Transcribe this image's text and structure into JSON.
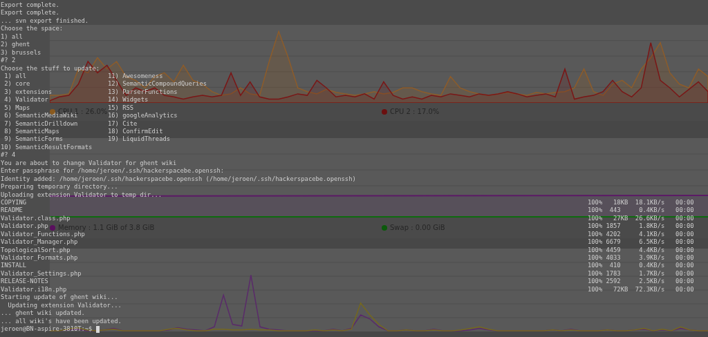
{
  "monitor": {
    "cpu_legend": [
      {
        "label": "CPU 1 : 26.0%",
        "color": "#8a5a1e"
      },
      {
        "label": "CPU 2 : 17.0%",
        "color": "#6b0f0f"
      }
    ],
    "memory_legend": [
      {
        "label": "Memory : 1.1 GiB of 3.8 GiB",
        "color": "#5a0f5e"
      },
      {
        "label": "Swap : 0.00 GiB",
        "color": "#0b5a0b"
      }
    ]
  },
  "terminal": {
    "lines": [
      {
        "kind": "text",
        "text": "Export complete."
      },
      {
        "kind": "text",
        "text": "Export complete."
      },
      {
        "kind": "text",
        "text": "... svn export finished."
      },
      {
        "kind": "text",
        "text": "Choose the space:"
      },
      {
        "kind": "text",
        "text": "1) all"
      },
      {
        "kind": "text",
        "text": "2) ghent"
      },
      {
        "kind": "text",
        "text": "3) brussels"
      },
      {
        "kind": "text",
        "text": "#? 2"
      },
      {
        "kind": "text",
        "text": "Choose the stuff to update:"
      },
      {
        "kind": "menu",
        "left": " 1) all",
        "right": "11) Awesomeness"
      },
      {
        "kind": "menu",
        "left": " 2) core",
        "right": "12) SemanticCompoundQueries"
      },
      {
        "kind": "menu",
        "left": " 3) extensions",
        "right": "13) ParserFunctions"
      },
      {
        "kind": "menu",
        "left": " 4) Validator",
        "right": "14) Widgets"
      },
      {
        "kind": "menu",
        "left": " 5) Maps",
        "right": "15) RSS"
      },
      {
        "kind": "menu",
        "left": " 6) SemanticMediaWiki",
        "right": "16) googleAnalytics"
      },
      {
        "kind": "menu",
        "left": " 7) SemanticDrilldown",
        "right": "17) Cite"
      },
      {
        "kind": "menu",
        "left": " 8) SemanticMaps",
        "right": "18) ConfirmEdit"
      },
      {
        "kind": "menu",
        "left": " 9) SemanticForms",
        "right": "19) LiquidThreads"
      },
      {
        "kind": "menu",
        "left": "10) SemanticResultFormats"
      },
      {
        "kind": "text",
        "text": "#? 4"
      },
      {
        "kind": "text",
        "text": "You are about to change Validator for ghent wiki"
      },
      {
        "kind": "text",
        "text": "Enter passphrase for /home/jeroen/.ssh/hackerspacebe.openssh:"
      },
      {
        "kind": "text",
        "text": "Identity added: /home/jeroen/.ssh/hackerspacebe.openssh (/home/jeroen/.ssh/hackerspacebe.openssh)"
      },
      {
        "kind": "text",
        "text": "Preparing temporary directory..."
      },
      {
        "kind": "text",
        "text": "Uploading extension Validator to temp dir..."
      },
      {
        "kind": "transfer",
        "name": "COPYING",
        "stats": "100%   18KB  18.1KB/s   00:00"
      },
      {
        "kind": "transfer",
        "name": "README",
        "stats": "100%  443     0.4KB/s   00:00"
      },
      {
        "kind": "transfer",
        "name": "Validator.class.php",
        "stats": "100%   27KB  26.6KB/s   00:00"
      },
      {
        "kind": "transfer",
        "name": "Validator.php",
        "stats": "100% 1857     1.8KB/s   00:00"
      },
      {
        "kind": "transfer",
        "name": "Validator_Functions.php",
        "stats": "100% 4202     4.1KB/s   00:00"
      },
      {
        "kind": "transfer",
        "name": "Validator_Manager.php",
        "stats": "100% 6679     6.5KB/s   00:00"
      },
      {
        "kind": "transfer",
        "name": "TopologicalSort.php",
        "stats": "100% 4459     4.4KB/s   00:00"
      },
      {
        "kind": "transfer",
        "name": "Validator_Formats.php",
        "stats": "100% 4033     3.9KB/s   00:00"
      },
      {
        "kind": "transfer",
        "name": "INSTALL",
        "stats": "100%  410     0.4KB/s   00:00"
      },
      {
        "kind": "transfer",
        "name": "Validator_Settings.php",
        "stats": "100% 1783     1.7KB/s   00:00"
      },
      {
        "kind": "transfer",
        "name": "RELEASE-NOTES",
        "stats": "100% 2592     2.5KB/s   00:00"
      },
      {
        "kind": "transfer",
        "name": "Validator.i18n.php",
        "stats": "100%   72KB  72.3KB/s   00:00"
      },
      {
        "kind": "text",
        "text": "Starting update of ghent wiki..."
      },
      {
        "kind": "text",
        "text": "  Updating extension Validator..."
      },
      {
        "kind": "text",
        "text": "... ghent wiki updated."
      },
      {
        "kind": "text",
        "text": "... all wiki's have been updated."
      },
      {
        "kind": "prompt",
        "text": "jeroen@BN-aspire-3810T:~$ "
      }
    ]
  }
}
